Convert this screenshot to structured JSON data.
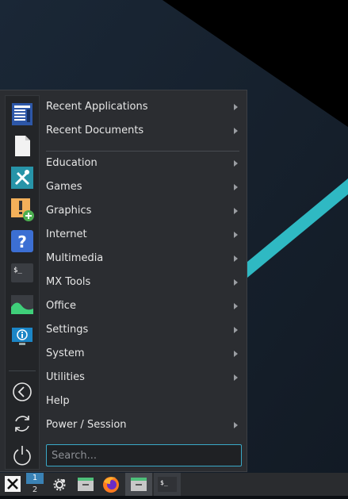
{
  "colors": {
    "menu_bg": "#2b2d31",
    "accent": "#3aa8c7",
    "text": "#e6e6e6",
    "desktop_teal": "#2fb9c3"
  },
  "sidebar": {
    "icons": [
      {
        "name": "recent-apps-icon"
      },
      {
        "name": "recent-docs-icon"
      },
      {
        "name": "settings-tools-icon"
      },
      {
        "name": "package-installer-icon"
      },
      {
        "name": "help-icon"
      },
      {
        "name": "terminal-icon"
      },
      {
        "name": "system-monitor-icon"
      },
      {
        "name": "system-info-icon"
      },
      {
        "name": "back-icon"
      },
      {
        "name": "refresh-icon"
      },
      {
        "name": "power-icon"
      }
    ]
  },
  "menu": {
    "items": [
      {
        "label": "Recent Applications",
        "submenu": true
      },
      {
        "label": "Recent Documents",
        "submenu": true
      },
      {
        "label": "Education",
        "submenu": true
      },
      {
        "label": "Games",
        "submenu": true
      },
      {
        "label": "Graphics",
        "submenu": true
      },
      {
        "label": "Internet",
        "submenu": true
      },
      {
        "label": "Multimedia",
        "submenu": true
      },
      {
        "label": "MX Tools",
        "submenu": true
      },
      {
        "label": "Office",
        "submenu": true
      },
      {
        "label": "Settings",
        "submenu": true
      },
      {
        "label": "System",
        "submenu": true
      },
      {
        "label": "Utilities",
        "submenu": true
      },
      {
        "label": "Help",
        "submenu": false
      },
      {
        "label": "Power / Session",
        "submenu": true
      }
    ],
    "search": {
      "placeholder": "Search...",
      "value": ""
    }
  },
  "panel": {
    "workspaces": [
      "1",
      "2"
    ],
    "active_workspace": "1",
    "launchers": [
      {
        "name": "start-menu-button-icon"
      },
      {
        "name": "settings-gear-icon"
      },
      {
        "name": "file-manager-icon"
      },
      {
        "name": "firefox-icon"
      },
      {
        "name": "file-manager-task-icon"
      },
      {
        "name": "terminal-task-icon"
      }
    ]
  }
}
